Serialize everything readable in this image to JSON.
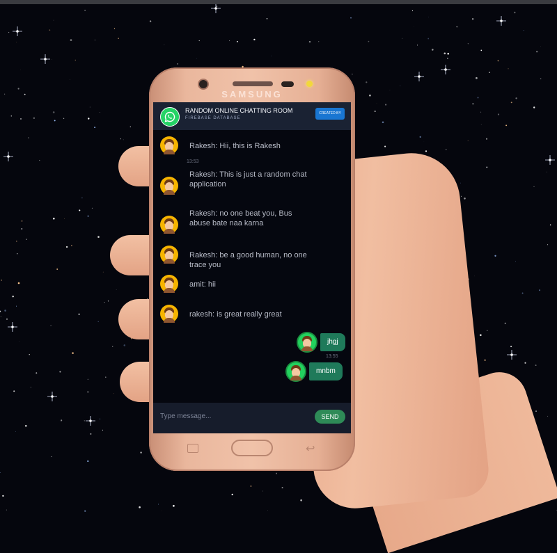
{
  "phone": {
    "brand": "SAMSUNG"
  },
  "app": {
    "title": "RANDOM ONLINE CHATTING ROOM",
    "subtitle": "FIREBASE DATABASE",
    "created_label": "CREATED BY"
  },
  "messages": [
    {
      "text": "Rakesh: Hii, this is Rakesh",
      "time": "13:53"
    },
    {
      "text": "Rakesh: This is just a random chat application"
    },
    {
      "text": "Rakesh: no one beat you, Bus abuse bate naa karna"
    },
    {
      "text": "Rakesh: be a good human, no one trace you"
    },
    {
      "text": "amit: hii"
    },
    {
      "text": "rakesh: is great really great"
    }
  ],
  "outgoing": [
    {
      "text": "jhgj",
      "time": "13:55"
    },
    {
      "text": "mnbm"
    }
  ],
  "composer": {
    "placeholder": "Type message...",
    "send_label": "SEND"
  },
  "colors": {
    "accent": "#25d366",
    "send": "#2e8b57",
    "bubble": "#1f7a5a",
    "created": "#1976d2"
  }
}
